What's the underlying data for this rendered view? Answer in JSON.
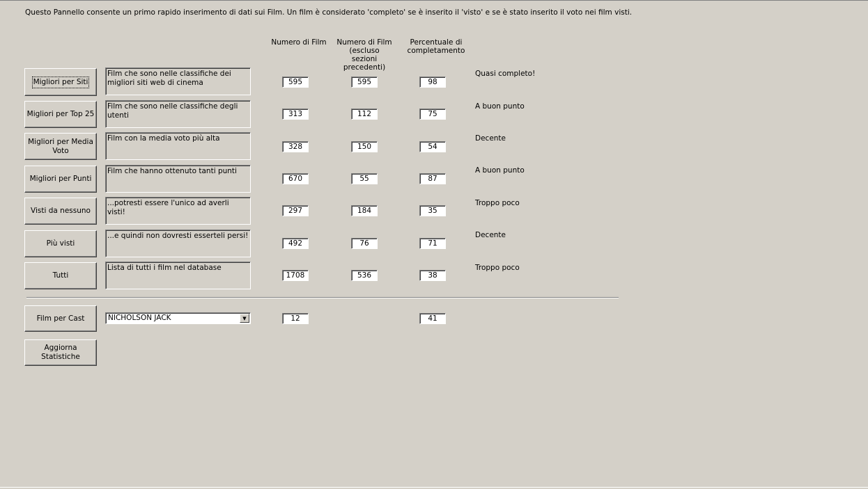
{
  "intro_text": "Questo Pannello consente un primo rapido inserimento di dati sui Film. Un film è considerato 'completo' se è inserito il 'visto' e se è stato inserito il voto nei film visti.",
  "headers": {
    "count": "Numero di Film",
    "count_excl_l1": "Numero di Film",
    "count_excl_l2": "(escluso sezioni",
    "count_excl_l3": "precedenti)",
    "pct_l1": "Percentuale di",
    "pct_l2": "completamento"
  },
  "rows": [
    {
      "button": "Migliori per Siti",
      "description": "Film che sono nelle classifiche dei migliori siti web di cinema",
      "count": "595",
      "count_excl": "595",
      "percent": "98",
      "status": "Quasi completo!"
    },
    {
      "button": "Migliori per Top 25",
      "description": "Film che sono nelle classifiche degli utenti",
      "count": "313",
      "count_excl": "112",
      "percent": "75",
      "status": "A buon punto"
    },
    {
      "button": "Migliori per Media Voto",
      "description": "Film con la media voto più alta",
      "count": "328",
      "count_excl": "150",
      "percent": "54",
      "status": "Decente"
    },
    {
      "button": "Migliori per Punti",
      "description": "Film che hanno ottenuto tanti punti",
      "count": "670",
      "count_excl": "55",
      "percent": "87",
      "status": "A buon punto"
    },
    {
      "button": "Visti da nessuno",
      "description": "...potresti essere l'unico ad averli visti!",
      "count": "297",
      "count_excl": "184",
      "percent": "35",
      "status": "Troppo poco"
    },
    {
      "button": "Più visti",
      "description": "...e quindi non dovresti esserteli persi!",
      "count": "492",
      "count_excl": "76",
      "percent": "71",
      "status": "Decente"
    },
    {
      "button": "Tutti",
      "description": "Lista di tutti i film nel database",
      "count": "1708",
      "count_excl": "536",
      "percent": "38",
      "status": "Troppo poco"
    }
  ],
  "cast": {
    "button": "Film per Cast",
    "selected": "NICHOLSON JACK",
    "count": "12",
    "percent": "41"
  },
  "refresh_button": "Aggiorna Statistiche"
}
